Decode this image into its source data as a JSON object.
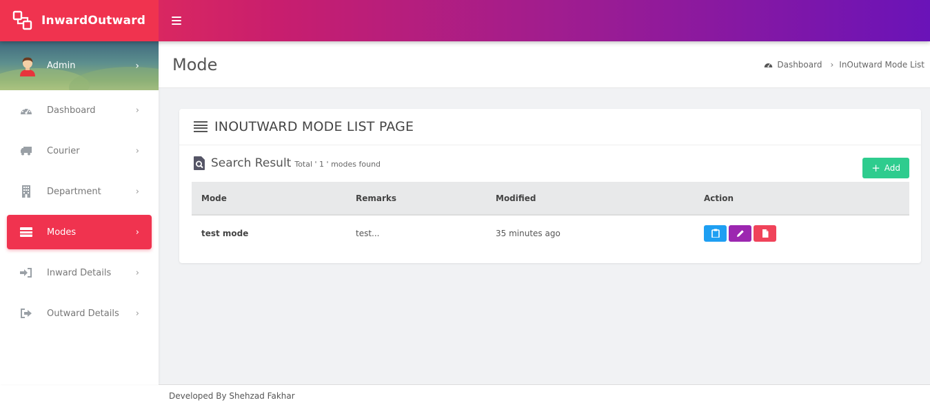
{
  "app": {
    "brand_name": "InwardOutward",
    "accent_color": "#f0334f"
  },
  "sidebar": {
    "user": {
      "name": "Admin"
    },
    "items": [
      {
        "label": "Dashboard",
        "icon": "dashboard-icon",
        "active": false
      },
      {
        "label": "Courier",
        "icon": "truck-icon",
        "active": false
      },
      {
        "label": "Department",
        "icon": "building-icon",
        "active": false
      },
      {
        "label": "Modes",
        "icon": "modes-icon",
        "active": true
      },
      {
        "label": "Inward Details",
        "icon": "sign-in-icon",
        "active": false
      },
      {
        "label": "Outward Details",
        "icon": "sign-out-icon",
        "active": false
      }
    ]
  },
  "page": {
    "title": "Mode",
    "breadcrumb": [
      "Dashboard",
      "InOutward Mode List"
    ]
  },
  "card": {
    "title": "INOUTWARD MODE LIST PAGE",
    "search_title": "Search Result",
    "search_count": "Total ' 1 ' modes found",
    "add_label": "Add"
  },
  "table": {
    "columns": [
      "Mode",
      "Remarks",
      "Modified",
      "Action"
    ],
    "rows": [
      {
        "mode": "test mode",
        "remarks": "test...",
        "modified": "35 minutes ago"
      }
    ]
  },
  "footer": {
    "text": "Developed By Shehzad Fakhar"
  }
}
